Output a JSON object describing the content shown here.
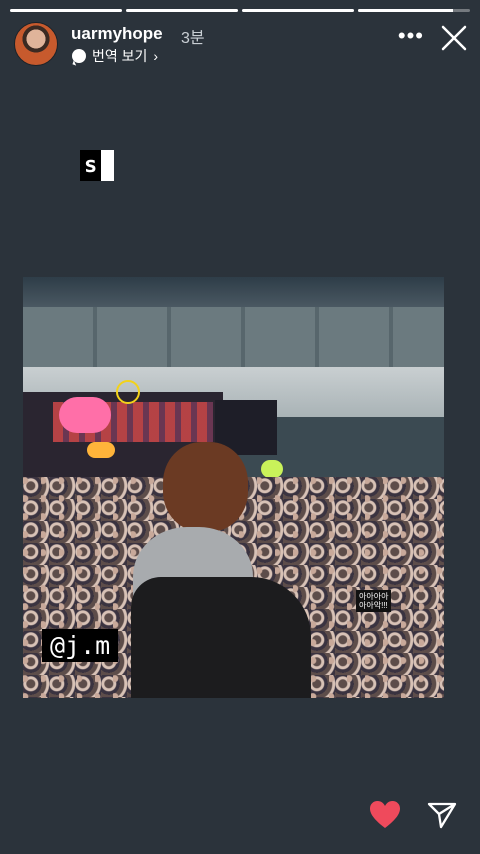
{
  "story": {
    "progress": [
      1,
      1,
      1,
      0.85
    ]
  },
  "header": {
    "username": "uarmyhope",
    "time": "3분",
    "translate_label": "번역 보기",
    "more_label": "•••"
  },
  "sticker": {
    "text": "s"
  },
  "photo": {
    "tag_text": "@j.m",
    "fan_sign_line1": "아아아아",
    "fan_sign_line2": "아아악!!!"
  },
  "colors": {
    "background": "#2b333b",
    "heart": "#ef4a5c"
  },
  "icons": {
    "close": "close-icon",
    "heart": "heart-icon",
    "send": "send-icon",
    "translate": "speech-bubble-icon"
  }
}
